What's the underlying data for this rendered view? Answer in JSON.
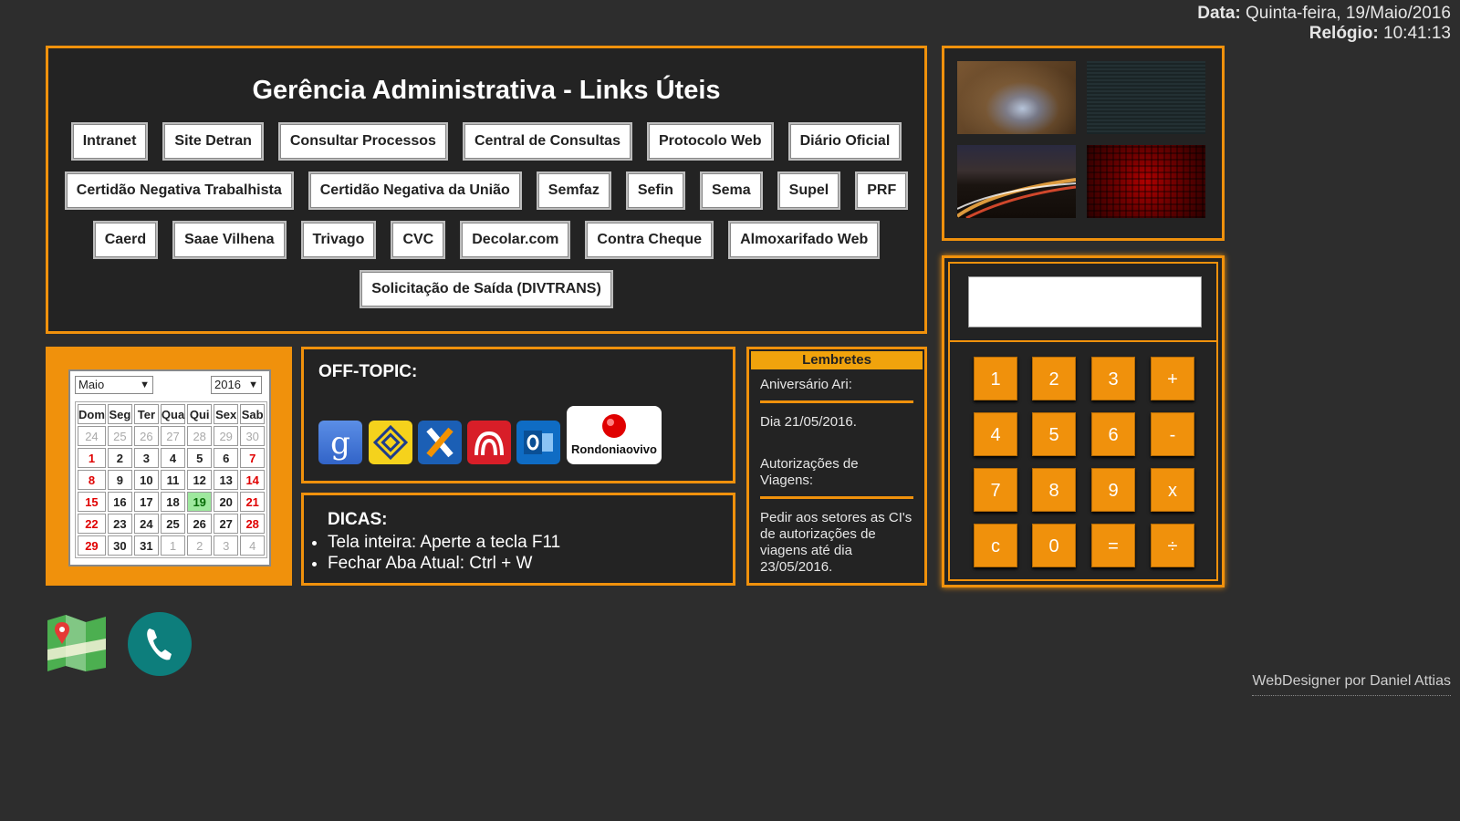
{
  "header": {
    "date_label": "Data:",
    "date_value": "Quinta-feira, 19/Maio/2016",
    "clock_label": "Relógio:",
    "clock_value": "10:41:13"
  },
  "links": {
    "title": "Gerência Administrativa - Links Úteis",
    "rows": [
      [
        "Intranet",
        "Site Detran",
        "Consultar Processos",
        "Central de Consultas",
        "Protocolo Web",
        "Diário Oficial"
      ],
      [
        "Certidão Negativa Trabalhista",
        "Certidão Negativa da União",
        "Semfaz",
        "Sefin",
        "Sema",
        "Supel",
        "PRF"
      ],
      [
        "Caerd",
        "Saae Vilhena",
        "Trivago",
        "CVC",
        "Decolar.com",
        "Contra Cheque",
        "Almoxarifado Web"
      ],
      [
        "Solicitação de Saída (DIVTRANS)"
      ]
    ]
  },
  "gallery": {
    "images": [
      "gallery-image-1",
      "gallery-image-2",
      "gallery-image-3",
      "gallery-image-4"
    ]
  },
  "calculator": {
    "display": "",
    "keys": [
      [
        "1",
        "2",
        "3",
        "+"
      ],
      [
        "4",
        "5",
        "6",
        "-"
      ],
      [
        "7",
        "8",
        "9",
        "x"
      ],
      [
        "c",
        "0",
        "=",
        "÷"
      ]
    ]
  },
  "calendar": {
    "month": "Maio",
    "year": "2016",
    "weekdays": [
      "Dom",
      "Seg",
      "Ter",
      "Qua",
      "Qui",
      "Sex",
      "Sab"
    ],
    "weeks": [
      [
        "24",
        "25",
        "26",
        "27",
        "28",
        "29",
        "30"
      ],
      [
        "1",
        "2",
        "3",
        "4",
        "5",
        "6",
        "7"
      ],
      [
        "8",
        "9",
        "10",
        "11",
        "12",
        "13",
        "14"
      ],
      [
        "15",
        "16",
        "17",
        "18",
        "19",
        "20",
        "21"
      ],
      [
        "22",
        "23",
        "24",
        "25",
        "26",
        "27",
        "28"
      ],
      [
        "29",
        "30",
        "31",
        "1",
        "2",
        "3",
        "4"
      ]
    ],
    "today": "19"
  },
  "offtopic": {
    "title": "OFF-TOPIC:",
    "icons": [
      "google-icon",
      "banco-do-brasil-icon",
      "caixa-icon",
      "bradesco-icon",
      "outlook-icon",
      "rondoniaovivo-logo"
    ],
    "rondonia_label": "Rondoniaovivo"
  },
  "dicas": {
    "title": "DICAS:",
    "items": [
      "Tela inteira: Aperte a tecla F11",
      "Fechar Aba Atual: Ctrl + W"
    ]
  },
  "lembretes": {
    "title": "Lembretes",
    "entries": [
      "Aniversário Ari:",
      "Dia 21/05/2016.",
      "Autorizações de Viagens:",
      "Pedir aos setores as CI's de autorizações de viagens até dia 23/05/2016."
    ]
  },
  "bottom_icons": [
    "maps-icon",
    "phone-icon"
  ],
  "footer": {
    "credit": "WebDesigner por Daniel Attias"
  },
  "colors": {
    "accent": "#f0910c",
    "background": "#2d2d2d",
    "panel": "#232323"
  }
}
